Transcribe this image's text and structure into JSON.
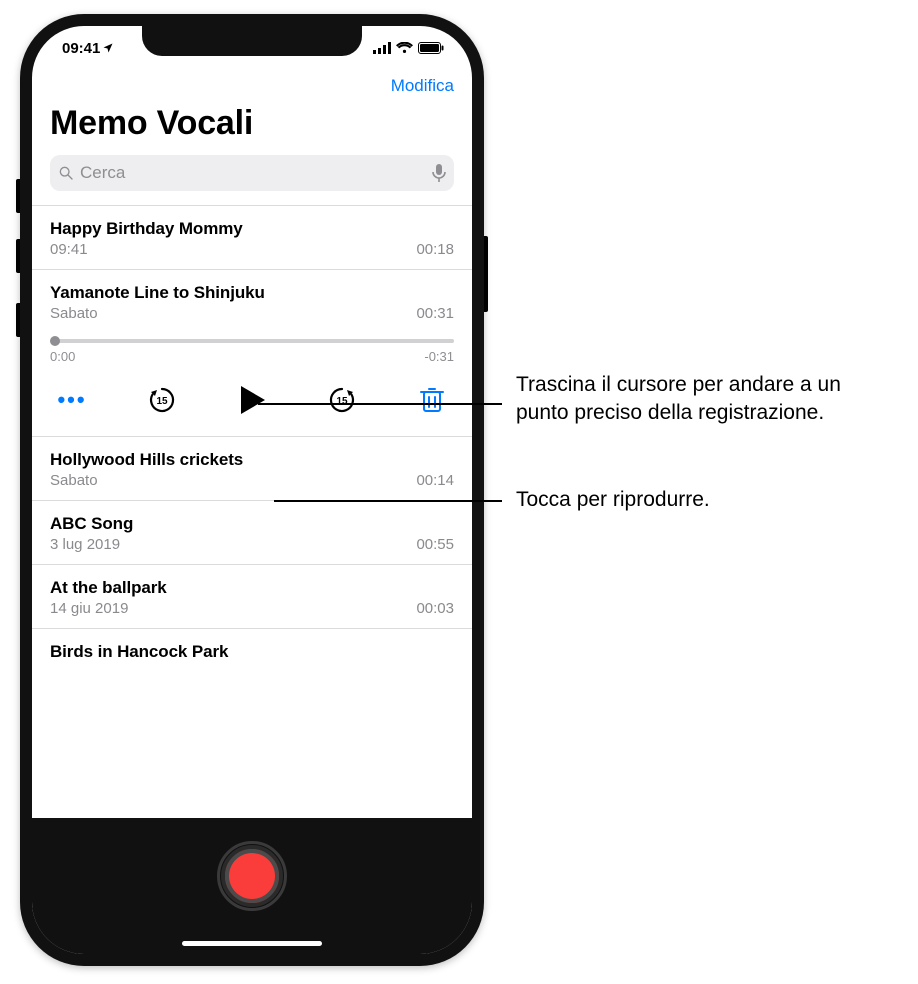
{
  "status": {
    "time": "09:41"
  },
  "nav": {
    "edit": "Modifica"
  },
  "title": "Memo Vocali",
  "search": {
    "placeholder": "Cerca"
  },
  "memos": {
    "r0": {
      "title": "Happy Birthday Mommy",
      "subtitle": "09:41",
      "duration": "00:18"
    },
    "r1": {
      "title": "Yamanote Line to Shinjuku",
      "subtitle": "Sabato",
      "duration": "00:31"
    },
    "r2": {
      "title": "Hollywood Hills crickets",
      "subtitle": "Sabato",
      "duration": "00:14"
    },
    "r3": {
      "title": "ABC Song",
      "subtitle": "3 lug 2019",
      "duration": "00:55"
    },
    "r4": {
      "title": "At the ballpark",
      "subtitle": "14 giu 2019",
      "duration": "00:03"
    },
    "r5": {
      "title": "Birds in Hancock Park"
    }
  },
  "player": {
    "elapsed": "0:00",
    "remaining": "-0:31"
  },
  "callouts": {
    "scrub": "Trascina il cursore per andare a un punto preciso della registrazione.",
    "play": "Tocca per riprodurre."
  }
}
